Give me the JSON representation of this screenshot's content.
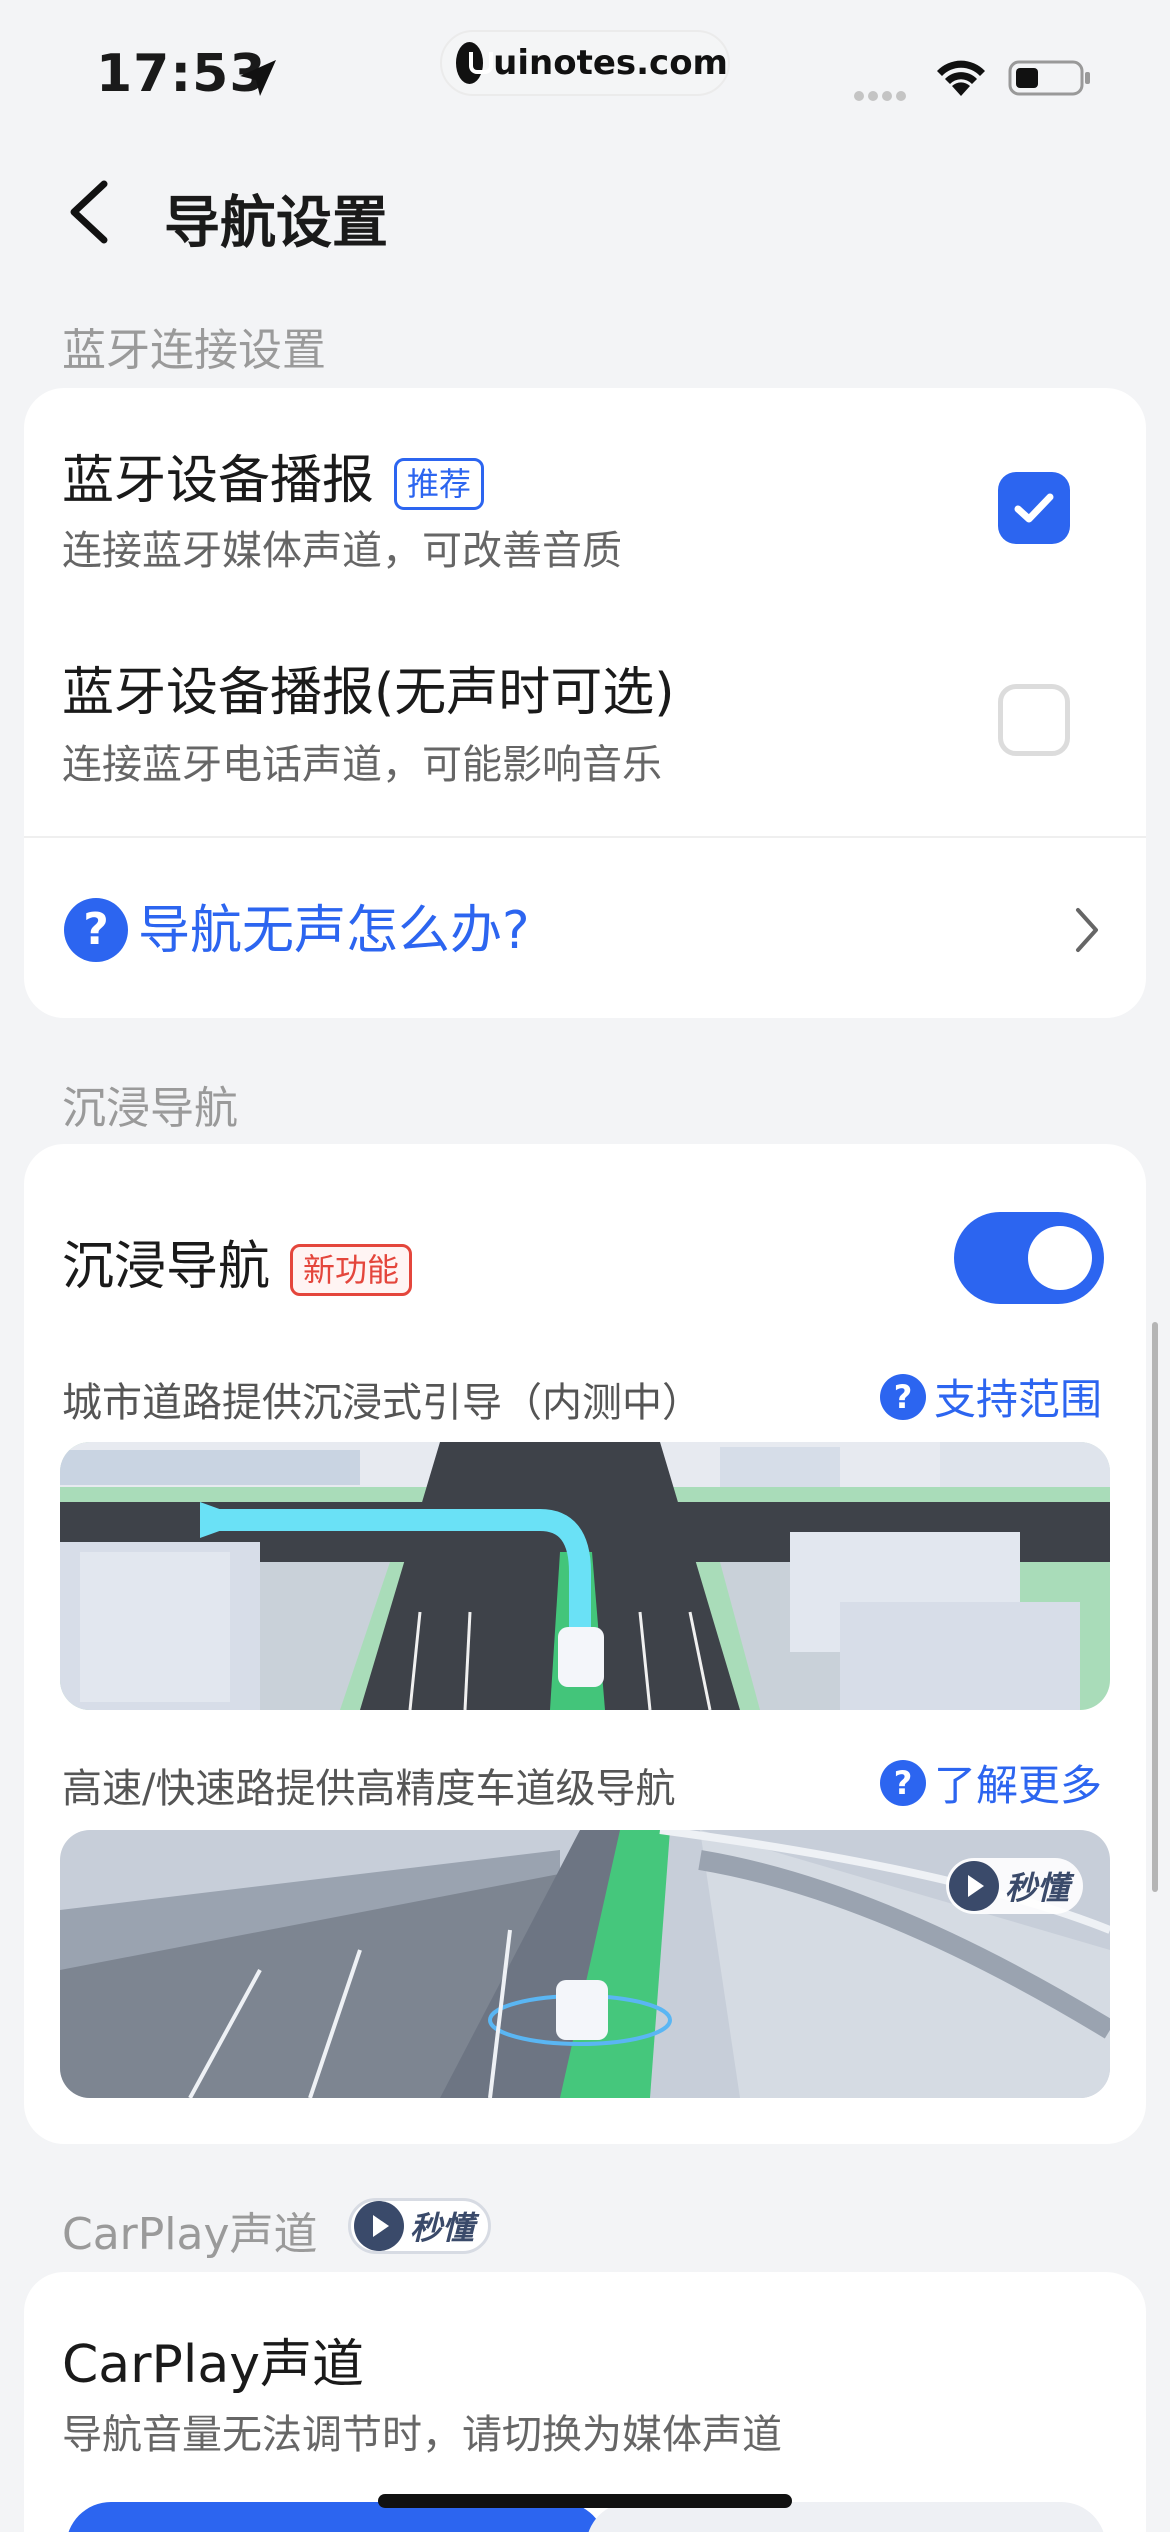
{
  "status_bar": {
    "time": "17:53",
    "watermark": "uinotes.com"
  },
  "header": {
    "title": "导航设置"
  },
  "bluetooth": {
    "section_label": "蓝牙连接设置",
    "option1": {
      "title": "蓝牙设备播报",
      "badge": "推荐",
      "subtitle": "连接蓝牙媒体声道，可改善音质",
      "checked": true
    },
    "option2": {
      "title": "蓝牙设备播报(无声时可选)",
      "subtitle": "连接蓝牙电话声道，可能影响音乐",
      "checked": false
    },
    "help_link": "导航无声怎么办?",
    "help_icon_glyph": "?"
  },
  "immersive": {
    "section_label": "沉浸导航",
    "title": "沉浸导航",
    "badge": "新功能",
    "enabled": true,
    "city": {
      "desc": "城市道路提供沉浸式引导（内测中）",
      "link": "支持范围"
    },
    "highway": {
      "desc": "高速/快速路提供高精度车道级导航",
      "link": "了解更多",
      "video_badge": "秒懂"
    }
  },
  "carplay": {
    "section_label": "CarPlay声道",
    "section_badge": "秒懂",
    "title": "CarPlay声道",
    "subtitle": "导航音量无法调节时，请切换为媒体声道"
  },
  "colors": {
    "accent": "#2c65f0",
    "new_badge": "#e4463c",
    "background": "#f3f4f6"
  }
}
